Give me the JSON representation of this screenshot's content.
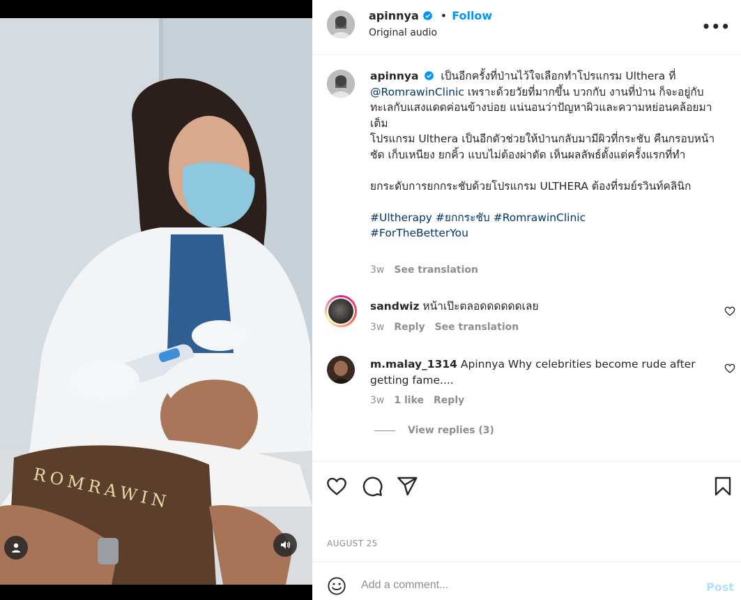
{
  "post": {
    "username": "apinnya",
    "follow_label": "Follow",
    "dot": "•",
    "audio_label": "Original audio",
    "more_label": "•••"
  },
  "caption": {
    "username": "apinnya",
    "line1": "เป็นอีกครั้งที่ป่านไว้ใจเลือกทำโปรแกรม Ulthera ที่",
    "mention": "@RomrawinClinic",
    "line2": " เพราะด้วยวัยที่มากขึ้น บวกกับ งานที่ป่าน ก็จะอยู่กับทะเลกับแสงแดดค่อนข้างบ่อย แน่นอนว่าปัญหาผิวและความหย่อนคล้อยมาเต็ม",
    "line3": "โปรแกรม Ulthera เป็นอีกตัวช่วยให้ป่านกลับมามีผิวที่กระชับ คืนกรอบหน้าชัด เก็บเหนียง ยกคิ้ว แบบไม่ต้องผ่าตัด เห็นผลลัพธ์ตั้งแต่ครั้งแรกที่ทำ",
    "line4": "ยกระดับการยกกระชับด้วยโปรแกรม ULTHERA ต้องที่รมย์รวินท์คลินิก",
    "hashtags": [
      "#Ultherapy",
      "#ยกกระชับ",
      "#RomrawinClinic",
      "#ForTheBetterYou"
    ],
    "time": "3w",
    "see_translation": "See translation"
  },
  "comments": [
    {
      "username": "sandwiz",
      "text": "หน้าเป๊ะตลอดดดดดดเลย",
      "time": "3w",
      "reply_label": "Reply",
      "see_translation": "See translation"
    },
    {
      "username": "m.malay_1314",
      "text": "Apinnya Why celebrities become rude after getting fame....",
      "time": "3w",
      "likes": "1 like",
      "reply_label": "Reply"
    }
  ],
  "view_replies": "View replies (3)",
  "date": "AUGUST 25",
  "add_comment": {
    "placeholder": "Add a comment...",
    "post_label": "Post"
  },
  "video": {
    "banner_text": "ROMRAWIN"
  },
  "icons": {
    "verified": "verified-badge-icon",
    "like": "heart-icon",
    "comment": "comment-bubble-icon",
    "share": "paper-plane-icon",
    "save": "bookmark-icon",
    "emoji": "emoji-smile-icon",
    "user": "user-tag-icon",
    "sound": "speaker-icon"
  },
  "colors": {
    "accent": "#0095f6",
    "hashtag": "#00376b",
    "muted": "#8e8e8e",
    "post_disabled": "#b2dffc"
  }
}
